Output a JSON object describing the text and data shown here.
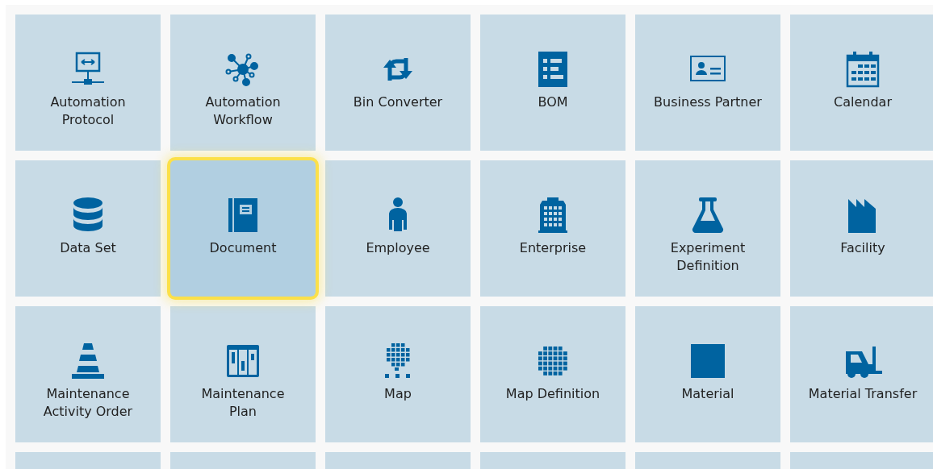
{
  "tiles": [
    {
      "label": "Automation\nProtocol",
      "selected": false
    },
    {
      "label": "Automation\nWorkflow",
      "selected": false
    },
    {
      "label": "Bin Converter",
      "selected": false
    },
    {
      "label": "BOM",
      "selected": false
    },
    {
      "label": "Business Partner",
      "selected": false
    },
    {
      "label": "Calendar",
      "selected": false
    },
    {
      "label": "Data Set",
      "selected": false
    },
    {
      "label": "Document",
      "selected": true
    },
    {
      "label": "Employee",
      "selected": false
    },
    {
      "label": "Enterprise",
      "selected": false
    },
    {
      "label": "Experiment\nDefinition",
      "selected": false
    },
    {
      "label": "Facility",
      "selected": false
    },
    {
      "label": "Maintenance\nActivity Order",
      "selected": false
    },
    {
      "label": "Maintenance\nPlan",
      "selected": false
    },
    {
      "label": "Map",
      "selected": false
    },
    {
      "label": "Map Definition",
      "selected": false
    },
    {
      "label": "Material",
      "selected": false
    },
    {
      "label": "Material Transfer",
      "selected": false
    }
  ]
}
